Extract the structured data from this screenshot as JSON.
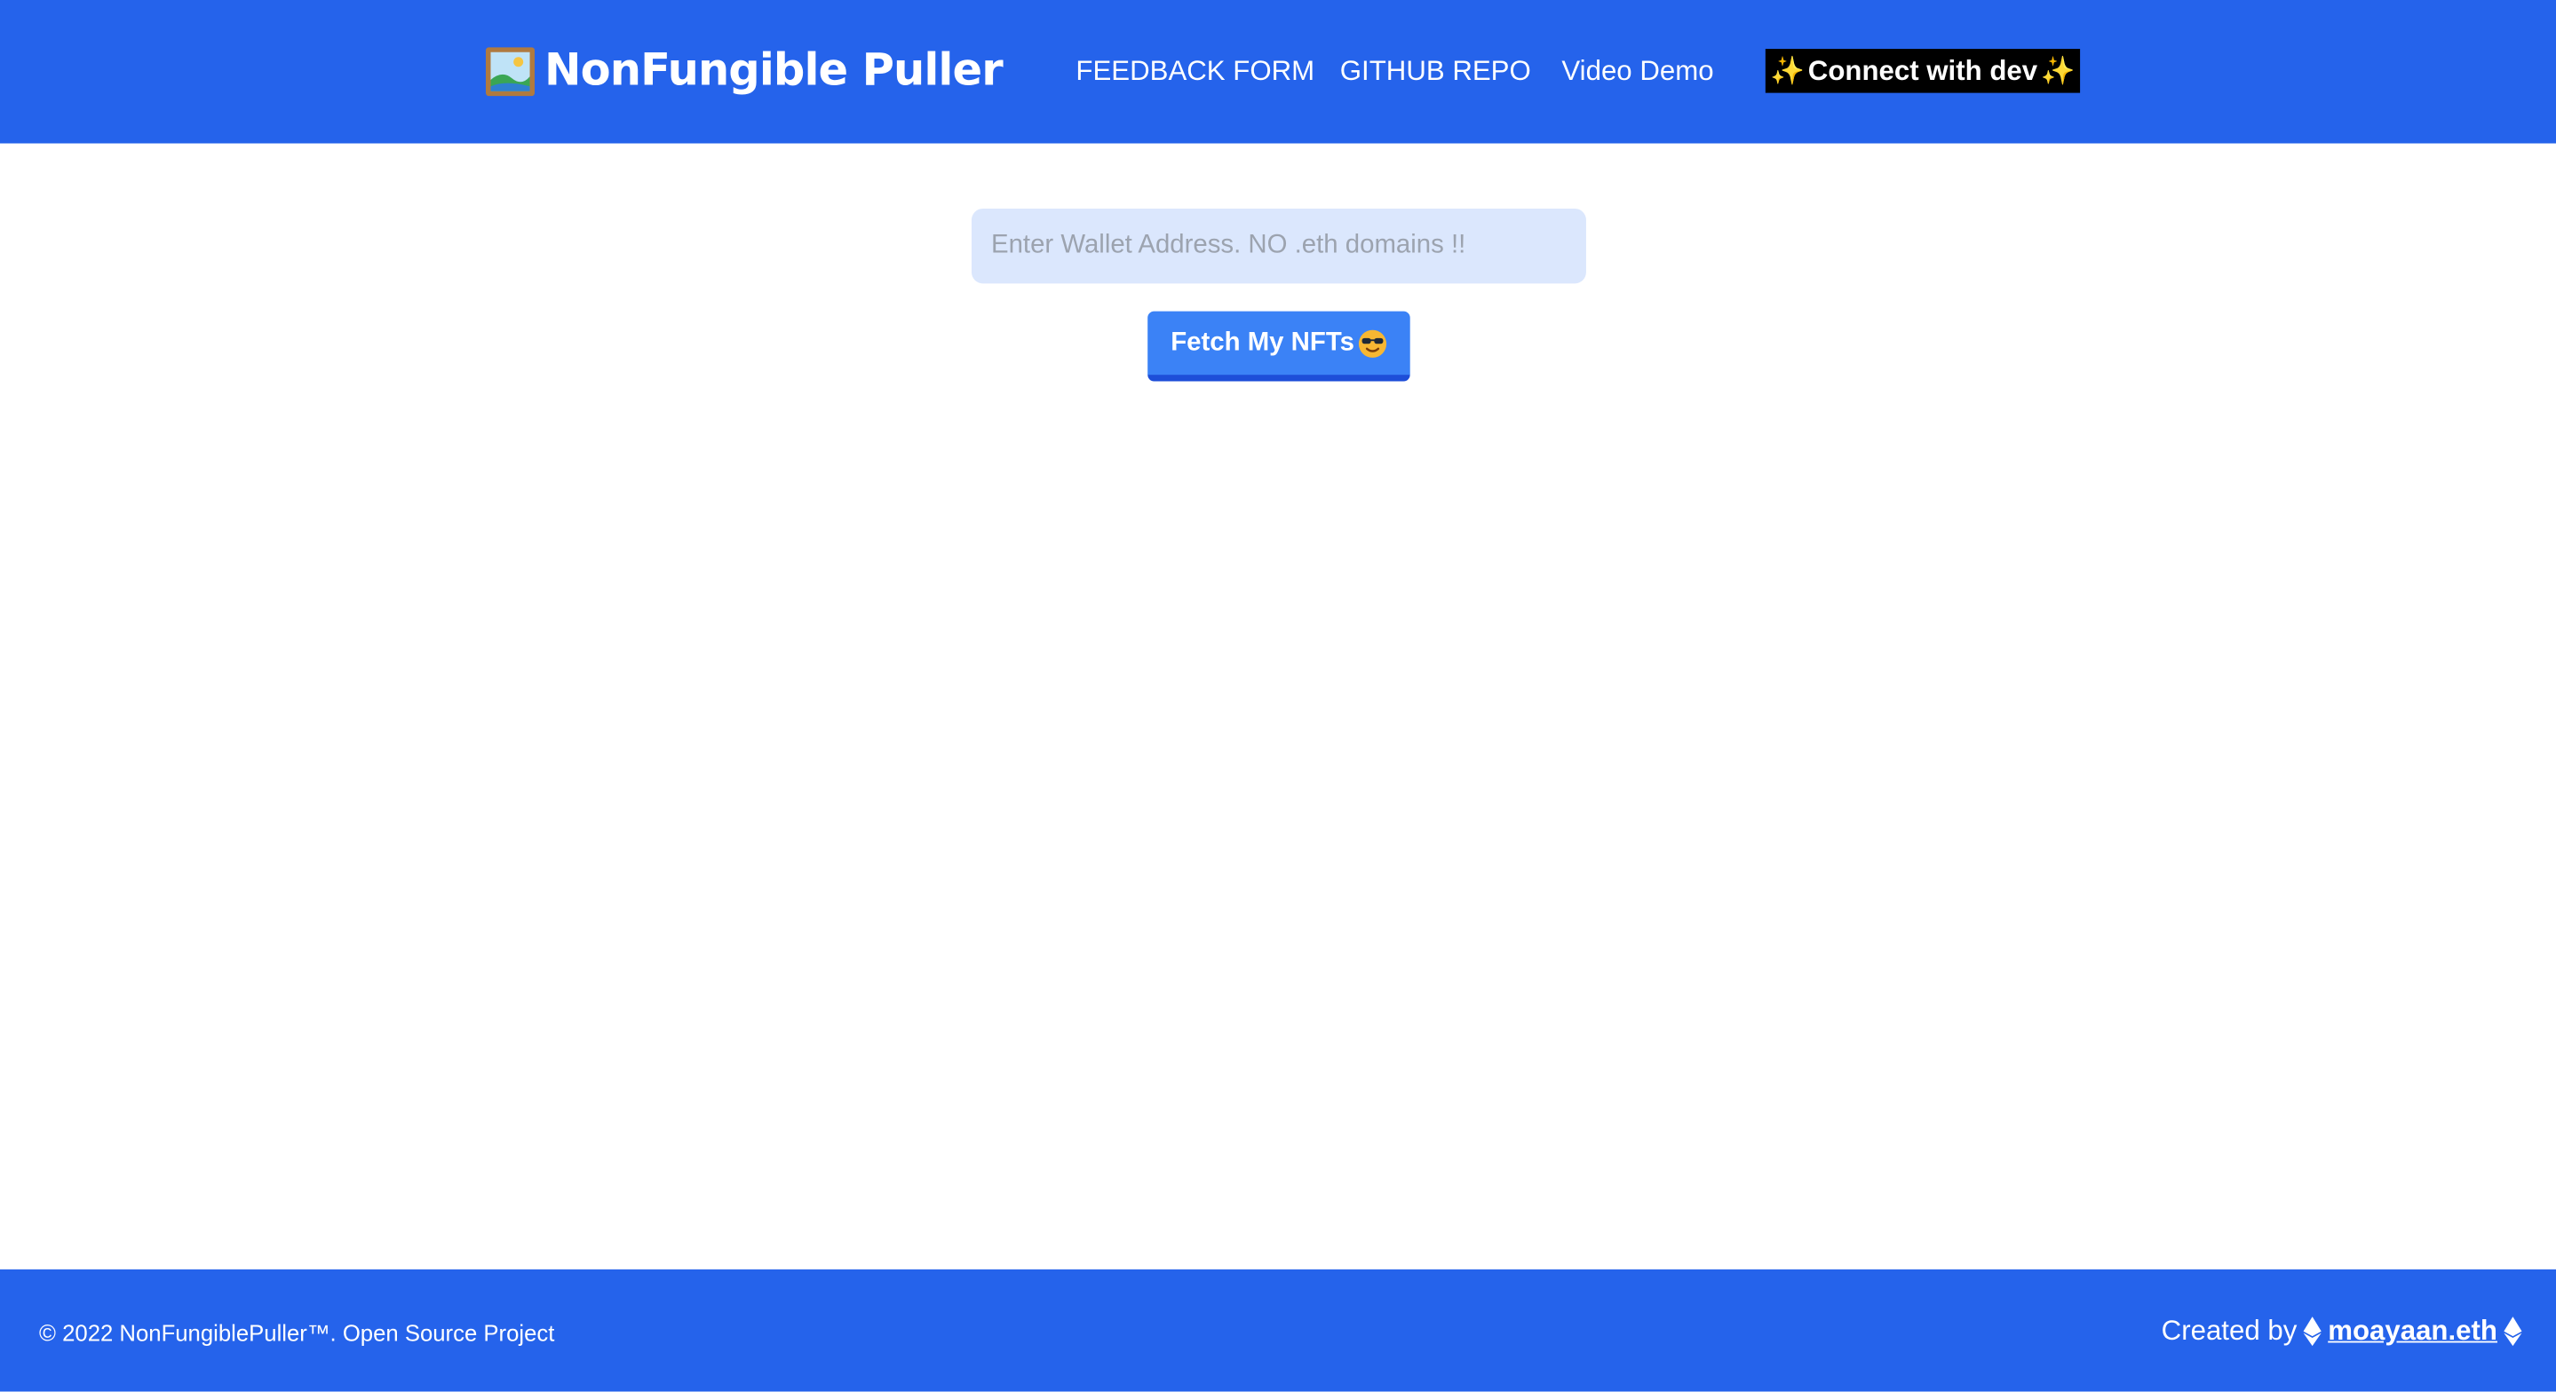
{
  "header": {
    "title": "NonFungible Puller",
    "brand_icon": "framed-picture-icon",
    "nav": {
      "feedback": "FEEDBACK FORM",
      "github": "GITHUB REPO",
      "video": "Video Demo"
    },
    "connect_label": "Connect with dev",
    "connect_icon": "sparkles-icon"
  },
  "main": {
    "wallet_placeholder": "Enter Wallet Address. NO .eth domains !!",
    "wallet_value": "",
    "fetch_label": "Fetch My NFTs",
    "fetch_icon": "sunglasses-face-icon"
  },
  "footer": {
    "copyright": "© 2022 NonFungiblePuller™. Open Source Project",
    "credit_prefix": "Created by",
    "author": "moayaan.eth",
    "author_icon": "ethereum-icon"
  },
  "colors": {
    "brand_blue": "#2563eb",
    "button_blue": "#3b82f6",
    "button_border": "#1d4ed8",
    "input_bg": "#dbe7fd",
    "connect_bg": "#000000",
    "sparkle": "#fbbf24"
  }
}
